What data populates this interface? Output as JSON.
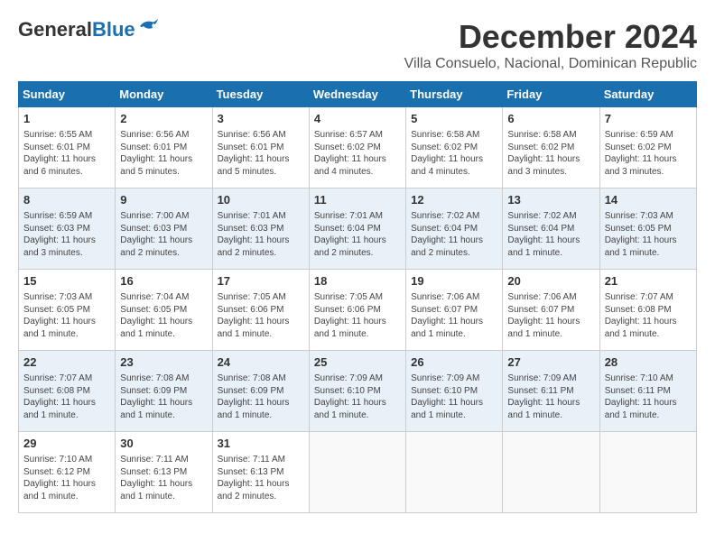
{
  "header": {
    "logo_general": "General",
    "logo_blue": "Blue",
    "month": "December 2024",
    "location": "Villa Consuelo, Nacional, Dominican Republic"
  },
  "weekdays": [
    "Sunday",
    "Monday",
    "Tuesday",
    "Wednesday",
    "Thursday",
    "Friday",
    "Saturday"
  ],
  "weeks": [
    [
      {
        "day": "1",
        "info": "Sunrise: 6:55 AM\nSunset: 6:01 PM\nDaylight: 11 hours and 6 minutes."
      },
      {
        "day": "2",
        "info": "Sunrise: 6:56 AM\nSunset: 6:01 PM\nDaylight: 11 hours and 5 minutes."
      },
      {
        "day": "3",
        "info": "Sunrise: 6:56 AM\nSunset: 6:01 PM\nDaylight: 11 hours and 5 minutes."
      },
      {
        "day": "4",
        "info": "Sunrise: 6:57 AM\nSunset: 6:02 PM\nDaylight: 11 hours and 4 minutes."
      },
      {
        "day": "5",
        "info": "Sunrise: 6:58 AM\nSunset: 6:02 PM\nDaylight: 11 hours and 4 minutes."
      },
      {
        "day": "6",
        "info": "Sunrise: 6:58 AM\nSunset: 6:02 PM\nDaylight: 11 hours and 3 minutes."
      },
      {
        "day": "7",
        "info": "Sunrise: 6:59 AM\nSunset: 6:02 PM\nDaylight: 11 hours and 3 minutes."
      }
    ],
    [
      {
        "day": "8",
        "info": "Sunrise: 6:59 AM\nSunset: 6:03 PM\nDaylight: 11 hours and 3 minutes."
      },
      {
        "day": "9",
        "info": "Sunrise: 7:00 AM\nSunset: 6:03 PM\nDaylight: 11 hours and 2 minutes."
      },
      {
        "day": "10",
        "info": "Sunrise: 7:01 AM\nSunset: 6:03 PM\nDaylight: 11 hours and 2 minutes."
      },
      {
        "day": "11",
        "info": "Sunrise: 7:01 AM\nSunset: 6:04 PM\nDaylight: 11 hours and 2 minutes."
      },
      {
        "day": "12",
        "info": "Sunrise: 7:02 AM\nSunset: 6:04 PM\nDaylight: 11 hours and 2 minutes."
      },
      {
        "day": "13",
        "info": "Sunrise: 7:02 AM\nSunset: 6:04 PM\nDaylight: 11 hours and 1 minute."
      },
      {
        "day": "14",
        "info": "Sunrise: 7:03 AM\nSunset: 6:05 PM\nDaylight: 11 hours and 1 minute."
      }
    ],
    [
      {
        "day": "15",
        "info": "Sunrise: 7:03 AM\nSunset: 6:05 PM\nDaylight: 11 hours and 1 minute."
      },
      {
        "day": "16",
        "info": "Sunrise: 7:04 AM\nSunset: 6:05 PM\nDaylight: 11 hours and 1 minute."
      },
      {
        "day": "17",
        "info": "Sunrise: 7:05 AM\nSunset: 6:06 PM\nDaylight: 11 hours and 1 minute."
      },
      {
        "day": "18",
        "info": "Sunrise: 7:05 AM\nSunset: 6:06 PM\nDaylight: 11 hours and 1 minute."
      },
      {
        "day": "19",
        "info": "Sunrise: 7:06 AM\nSunset: 6:07 PM\nDaylight: 11 hours and 1 minute."
      },
      {
        "day": "20",
        "info": "Sunrise: 7:06 AM\nSunset: 6:07 PM\nDaylight: 11 hours and 1 minute."
      },
      {
        "day": "21",
        "info": "Sunrise: 7:07 AM\nSunset: 6:08 PM\nDaylight: 11 hours and 1 minute."
      }
    ],
    [
      {
        "day": "22",
        "info": "Sunrise: 7:07 AM\nSunset: 6:08 PM\nDaylight: 11 hours and 1 minute."
      },
      {
        "day": "23",
        "info": "Sunrise: 7:08 AM\nSunset: 6:09 PM\nDaylight: 11 hours and 1 minute."
      },
      {
        "day": "24",
        "info": "Sunrise: 7:08 AM\nSunset: 6:09 PM\nDaylight: 11 hours and 1 minute."
      },
      {
        "day": "25",
        "info": "Sunrise: 7:09 AM\nSunset: 6:10 PM\nDaylight: 11 hours and 1 minute."
      },
      {
        "day": "26",
        "info": "Sunrise: 7:09 AM\nSunset: 6:10 PM\nDaylight: 11 hours and 1 minute."
      },
      {
        "day": "27",
        "info": "Sunrise: 7:09 AM\nSunset: 6:11 PM\nDaylight: 11 hours and 1 minute."
      },
      {
        "day": "28",
        "info": "Sunrise: 7:10 AM\nSunset: 6:11 PM\nDaylight: 11 hours and 1 minute."
      }
    ],
    [
      {
        "day": "29",
        "info": "Sunrise: 7:10 AM\nSunset: 6:12 PM\nDaylight: 11 hours and 1 minute."
      },
      {
        "day": "30",
        "info": "Sunrise: 7:11 AM\nSunset: 6:13 PM\nDaylight: 11 hours and 1 minute."
      },
      {
        "day": "31",
        "info": "Sunrise: 7:11 AM\nSunset: 6:13 PM\nDaylight: 11 hours and 2 minutes."
      },
      {
        "day": "",
        "info": ""
      },
      {
        "day": "",
        "info": ""
      },
      {
        "day": "",
        "info": ""
      },
      {
        "day": "",
        "info": ""
      }
    ]
  ]
}
